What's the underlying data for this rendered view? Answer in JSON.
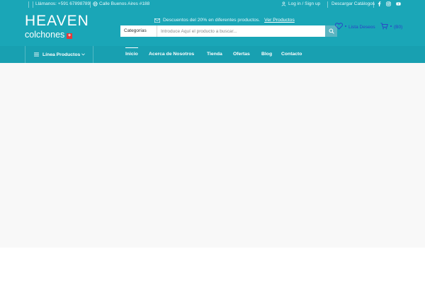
{
  "topbar": {
    "phone": "Llámanos: +591 67898789",
    "address": "Calle Buenos Aires #188",
    "login": "Log in / Sign up",
    "catalogs": "Descargar Catálogos",
    "social": [
      "facebook-icon",
      "instagram-icon",
      "youtube-icon"
    ]
  },
  "logo": {
    "main": "HEAVEN",
    "sub": "colchones",
    "flag": "+"
  },
  "promo": {
    "text": "Descuentos del 20% en diferentes productos.",
    "link": "Ver Productos"
  },
  "search": {
    "category": "Categorías",
    "placeholder": "Introduce Aquí el producto a buscar..."
  },
  "wishlist": {
    "label": "Lista Deseos"
  },
  "cart": {
    "label": "(B0)"
  },
  "nav": {
    "categories_label": "Línea Productos",
    "items": [
      "Inicio",
      "Acerca de Nosotros",
      "Tienda",
      "Ofertas",
      "Blog",
      "Contacto"
    ],
    "active": "Inicio"
  },
  "colors": {
    "brand": "#1aa6b7",
    "nav": "#18a0b1",
    "accent": "#2c3ec9",
    "content": "#f8f8f8"
  }
}
